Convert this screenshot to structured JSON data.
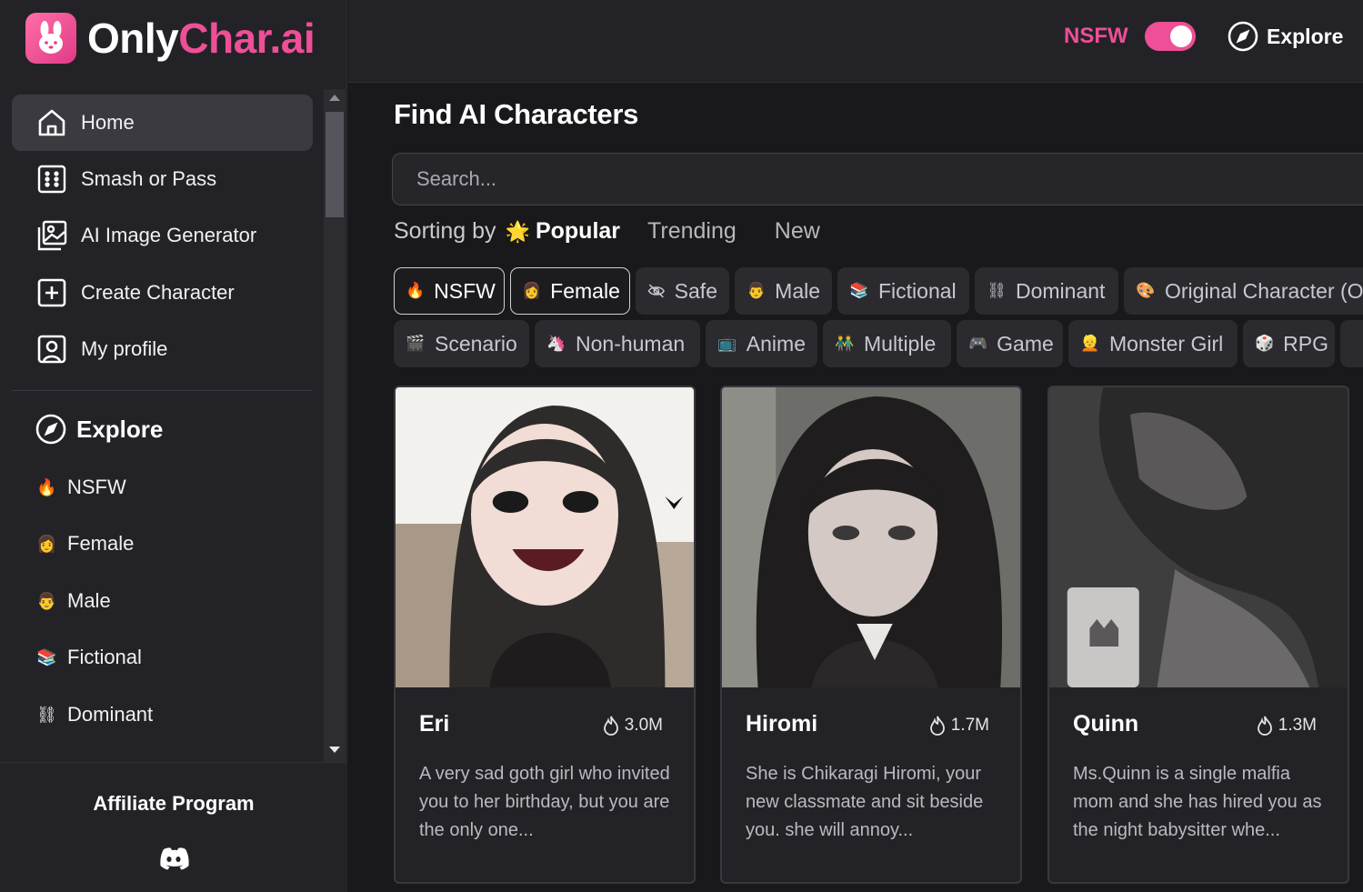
{
  "brand": {
    "name_white": "Only",
    "name_pink": "Char.ai"
  },
  "sidebar": {
    "items": [
      {
        "label": "Home",
        "icon": "home-icon"
      },
      {
        "label": "Smash or Pass",
        "icon": "dice-grid-icon"
      },
      {
        "label": "AI Image Generator",
        "icon": "image-icon"
      },
      {
        "label": "Create Character",
        "icon": "plus-square-icon"
      },
      {
        "label": "My profile",
        "icon": "user-square-icon"
      }
    ],
    "explore_label": "Explore",
    "categories": [
      {
        "label": "NSFW",
        "emoji": "🔥"
      },
      {
        "label": "Female",
        "emoji": "👩"
      },
      {
        "label": "Male",
        "emoji": "👨"
      },
      {
        "label": "Fictional",
        "emoji": "📚"
      },
      {
        "label": "Dominant",
        "emoji": "⛓"
      }
    ],
    "affiliate": "Affiliate Program"
  },
  "topbar": {
    "nsfw_label": "NSFW",
    "nsfw_enabled": true,
    "explore_label": "Explore"
  },
  "main": {
    "title": "Find AI Characters",
    "search_placeholder": "Search...",
    "sorting_label": "Sorting by",
    "sort_active": "Popular",
    "sort_active_emoji": "🌟",
    "sort_options": [
      "Trending",
      "New"
    ],
    "chips_row1": [
      {
        "label": "NSFW",
        "emoji": "🔥",
        "selected": true
      },
      {
        "label": "Female",
        "emoji": "👩",
        "selected": true
      },
      {
        "label": "Safe",
        "emoji": "",
        "selected": false
      },
      {
        "label": "Male",
        "emoji": "👨",
        "selected": false
      },
      {
        "label": "Fictional",
        "emoji": "📚",
        "selected": false
      },
      {
        "label": "Dominant",
        "emoji": "⛓",
        "selected": false
      },
      {
        "label": "Original Character (O",
        "emoji": "🎨",
        "selected": false
      }
    ],
    "chips_row2": [
      {
        "label": "Scenario",
        "emoji": "🎬"
      },
      {
        "label": "Non-human",
        "emoji": "🦄"
      },
      {
        "label": "Anime",
        "emoji": "📺"
      },
      {
        "label": "Multiple",
        "emoji": "👬"
      },
      {
        "label": "Game",
        "emoji": "🎮"
      },
      {
        "label": "Monster Girl",
        "emoji": "👱"
      },
      {
        "label": "RPG",
        "emoji": "🎲"
      }
    ],
    "cards": [
      {
        "name": "Eri",
        "views": "3.0M",
        "description": "A very sad goth girl who invited you to her birthday, but you are the only one..."
      },
      {
        "name": "Hiromi",
        "views": "1.7M",
        "description": "She is Chikaragi Hiromi, your new classmate and sit beside you. she will annoy..."
      },
      {
        "name": "Quinn",
        "views": "1.3M",
        "description": "Ms.Quinn is a single malfia mom and she has hired you as the night babysitter whe..."
      }
    ]
  },
  "colors": {
    "accent": "#ee4f97",
    "bg": "#19191c",
    "panel": "#232327"
  }
}
